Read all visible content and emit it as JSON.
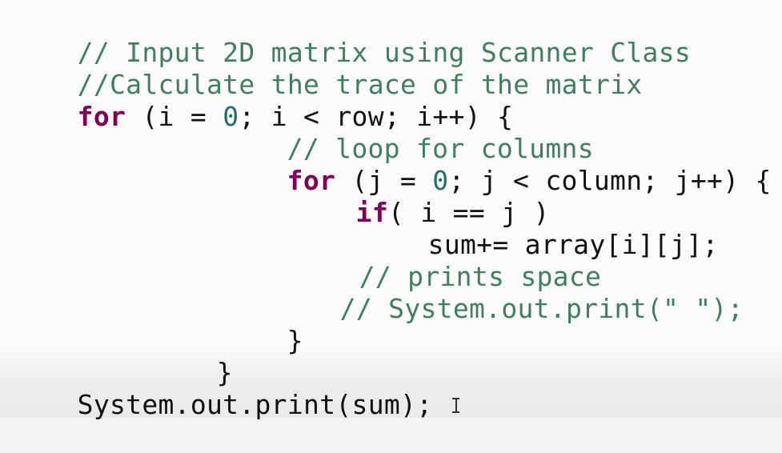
{
  "editor": {
    "colors": {
      "background": "#fbfbfb",
      "comment": "#3f7f5f",
      "keyword": "#7f0055",
      "number": "#1f6f6f",
      "text": "#111111"
    },
    "lines": {
      "l1": {
        "comment": "// Input 2D matrix using Scanner Class"
      },
      "l2": {
        "comment": "//Calculate the trace of the matrix"
      },
      "l3": {
        "keyword": "for",
        "pre_number": " (i = ",
        "number": "0",
        "post_number": "; i < row; i++) {"
      },
      "l4": {
        "comment": "// loop for columns"
      },
      "l5": {
        "keyword": "for",
        "pre_number": " (j = ",
        "number": "0",
        "post_number": "; j < column; j++) {"
      },
      "l6": {
        "keyword": "if",
        "text": "( i == j )"
      },
      "l7": {
        "text": "sum+= array[i][j];"
      },
      "l8": {
        "comment": "// prints space"
      },
      "l9": {
        "comment": "// System.out.print(\" \");"
      },
      "l10": {
        "text": "}"
      },
      "l11": {
        "text": "}"
      },
      "l12": {
        "text": "System.out.print(sum);"
      }
    },
    "cursor_icon": "text-cursor-icon"
  }
}
